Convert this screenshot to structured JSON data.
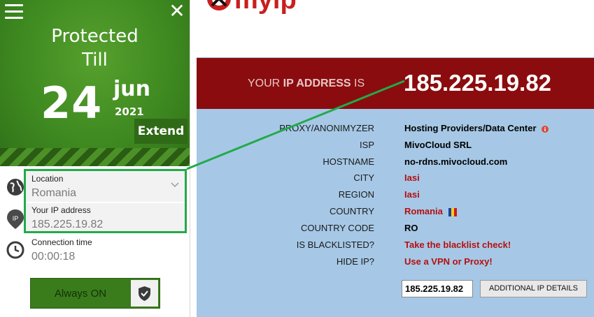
{
  "vpn": {
    "protected_line1": "Protected",
    "protected_line2": "Till",
    "day": "24",
    "month": "jun",
    "year": "2021",
    "extend_label": "Extend",
    "location_label": "Location",
    "location_value": "Romania",
    "ip_label": "Your IP address",
    "ip_value": "185.225.19.82",
    "ip_badge": "IP",
    "connection_label": "Connection time",
    "connection_value": "00:00:18",
    "always_on_label": "Always ON",
    "colors": {
      "green": "#3f8a21",
      "highlight": "#22aa4a"
    }
  },
  "myip": {
    "logo_text": "myip",
    "banner_label_pre": "YOUR ",
    "banner_label_bold": "IP ADDRESS",
    "banner_label_post": " IS",
    "banner_ip": "185.225.19.82",
    "rows": [
      {
        "key": "PROXY/ANONIMYZER",
        "value": "Hosting Providers/Data Center"
      },
      {
        "key": "ISP",
        "value": "MivoCloud SRL"
      },
      {
        "key": "HOSTNAME",
        "value": "no-rdns.mivocloud.com"
      },
      {
        "key": "CITY",
        "value": "Iasi"
      },
      {
        "key": "REGION",
        "value": "Iasi"
      },
      {
        "key": "COUNTRY",
        "value": "Romania"
      },
      {
        "key": "COUNTRY CODE",
        "value": "RO"
      },
      {
        "key": "IS BLACKLISTED?",
        "value": "Take the blacklist check!"
      },
      {
        "key": "HIDE IP?",
        "value": "Use a VPN or Proxy!"
      }
    ],
    "input_value": "185.225.19.82",
    "details_button": "ADDITIONAL IP DETAILS",
    "colors": {
      "banner": "#8b0c0e",
      "background": "#a6c8e6",
      "link": "#b50f0f"
    }
  }
}
